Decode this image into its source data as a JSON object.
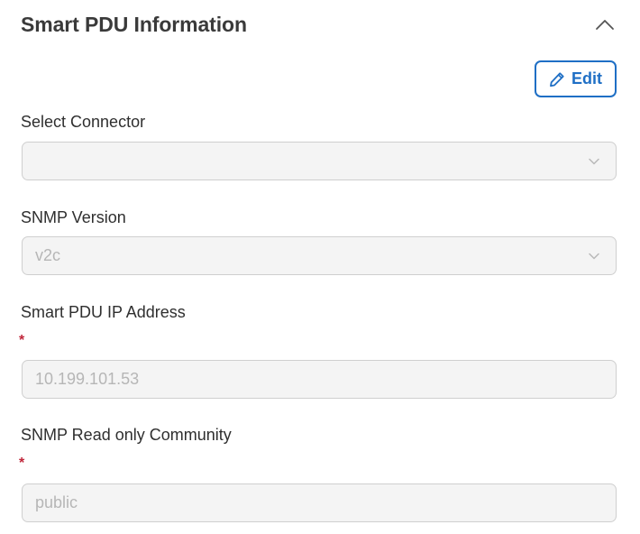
{
  "header": {
    "title": "Smart PDU Information",
    "collapse_icon": "chevron-up-icon"
  },
  "toolbar": {
    "edit_label": "Edit",
    "edit_icon": "pencil-icon"
  },
  "fields": {
    "connector": {
      "label": "Select Connector",
      "value": ""
    },
    "snmp_version": {
      "label": "SNMP Version",
      "value": "v2c"
    },
    "ip_address": {
      "label": "Smart PDU IP Address",
      "required_mark": "*",
      "value": "10.199.101.53"
    },
    "community": {
      "label": "SNMP Read only Community",
      "required_mark": "*",
      "value": "public"
    }
  },
  "colors": {
    "accent": "#1f6fc5",
    "required": "#c0263a",
    "disabled_bg": "#f4f4f4",
    "disabled_text": "#b6b6b6"
  }
}
